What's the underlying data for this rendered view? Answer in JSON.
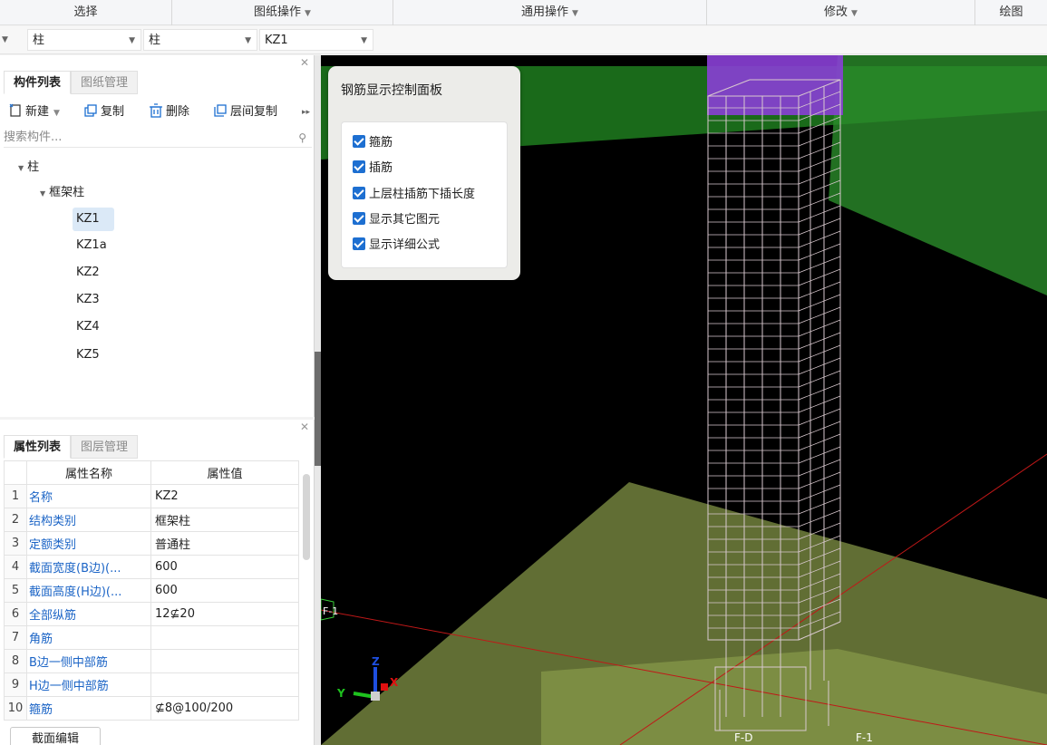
{
  "ribbon": {
    "groups": [
      {
        "label": "选择",
        "caret": ""
      },
      {
        "label": "图纸操作",
        "caret": "▼"
      },
      {
        "label": "通用操作",
        "caret": "▼"
      },
      {
        "label": "修改",
        "caret": "▼"
      },
      {
        "label": "绘图",
        "caret": ""
      }
    ]
  },
  "selectors": {
    "category": "柱",
    "type": "柱",
    "element": "KZ1"
  },
  "component_panel": {
    "tabs": [
      "构件列表",
      "图纸管理"
    ],
    "toolbar": {
      "new": "新建",
      "copy": "复制",
      "delete": "删除",
      "floor_copy": "层间复制"
    },
    "search_placeholder": "搜索构件...",
    "tree": {
      "root": "柱",
      "group": "框架柱",
      "items": [
        "KZ1",
        "KZ1a",
        "KZ2",
        "KZ3",
        "KZ4",
        "KZ5"
      ],
      "selected": "KZ1"
    }
  },
  "property_panel": {
    "tabs": [
      "属性列表",
      "图层管理"
    ],
    "headers": [
      "属性名称",
      "属性值"
    ],
    "rows": [
      {
        "n": "1",
        "name": "名称",
        "value": "KZ2"
      },
      {
        "n": "2",
        "name": "结构类别",
        "value": "框架柱"
      },
      {
        "n": "3",
        "name": "定额类别",
        "value": "普通柱"
      },
      {
        "n": "4",
        "name": "截面宽度(B边)(...",
        "value": "600"
      },
      {
        "n": "5",
        "name": "截面高度(H边)(...",
        "value": "600"
      },
      {
        "n": "6",
        "name": "全部纵筋",
        "value": "12⊈20"
      },
      {
        "n": "7",
        "name": "角筋",
        "value": ""
      },
      {
        "n": "8",
        "name": "B边一侧中部筋",
        "value": ""
      },
      {
        "n": "9",
        "name": "H边一侧中部筋",
        "value": ""
      },
      {
        "n": "10",
        "name": "箍筋",
        "value": "⊈8@100/200"
      }
    ],
    "section_edit_button": "截面编辑"
  },
  "rebar_panel": {
    "title": "钢筋显示控制面板",
    "options": [
      {
        "label": "箍筋",
        "checked": true
      },
      {
        "label": "插筋",
        "checked": true
      },
      {
        "label": "上层柱插筋下插长度",
        "checked": true
      },
      {
        "label": "显示其它图元",
        "checked": true
      },
      {
        "label": "显示详细公式",
        "checked": true
      }
    ]
  },
  "viewport": {
    "axis_labels": {
      "x": "X",
      "y": "Y",
      "z": "Z"
    },
    "grid_markers": [
      "F-1",
      "F-D",
      "F-1"
    ],
    "colors": {
      "background": "#000000",
      "beam": "#2f8f2f",
      "slab": "#6b7a3a",
      "column_top": "#8a3fd6",
      "rebar": "#d9c9cf",
      "grid_line": "#c01818"
    }
  }
}
